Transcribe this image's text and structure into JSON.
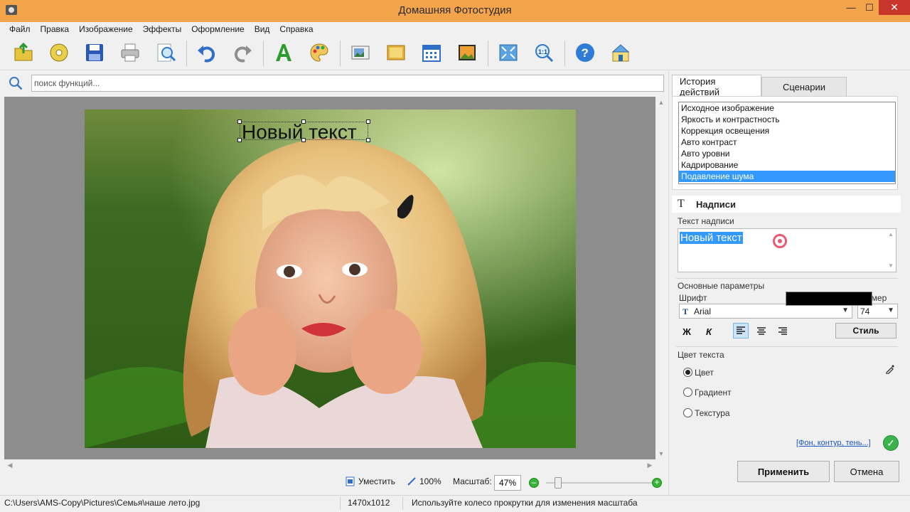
{
  "window": {
    "title": "Домашняя Фотостудия",
    "min_glyph": "—",
    "max_glyph": "☐",
    "close_glyph": "✕"
  },
  "menu": [
    "Файл",
    "Правка",
    "Изображение",
    "Эффекты",
    "Оформление",
    "Вид",
    "Справка"
  ],
  "toolbar": {
    "icons": [
      "open-folder-icon",
      "disc-icon",
      "save-icon",
      "print-icon",
      "preview-icon",
      "undo-icon",
      "redo-icon",
      "text-icon",
      "palette-icon",
      "image-frame-icon",
      "photo-icon",
      "calendar-icon",
      "postcard-icon",
      "fit-screen-icon",
      "zoom-1-1-icon",
      "help-icon",
      "home-icon"
    ]
  },
  "search": {
    "placeholder": "поиск функций..."
  },
  "canvas": {
    "caption": "Новый текст"
  },
  "zoom": {
    "fit_label": "Уместить",
    "actual_label": "100%",
    "scale_label": "Масштаб:",
    "value": "47%",
    "minus": "–",
    "plus": "+"
  },
  "status": {
    "path": "C:\\Users\\AMS-Copy\\Pictures\\Семья\\наше лето.jpg",
    "dimensions": "1470x1012",
    "hint": "Используйте колесо прокрутки для изменения масштаба"
  },
  "panel": {
    "tabs": [
      "История действий",
      "Сценарии"
    ],
    "history": [
      "Исходное изображение",
      "Яркость и контрастность",
      "Коррекция освещения",
      "Авто контраст",
      "Авто уровни",
      "Кадрирование",
      "Подавление шума"
    ],
    "selected_history_index": 6,
    "section_icon": "T",
    "section_title": "Надписи",
    "text_label": "Текст надписи",
    "text_value": "Новый текст",
    "basic_params": "Основные параметры",
    "font_label": "Шрифт",
    "font_icon": "T",
    "font_value": "Arial",
    "size_label": "Размер",
    "size_value": "74",
    "bold": "Ж",
    "italic": "К",
    "style_button": "Стиль",
    "color_section": "Цвет текста",
    "color_option": "Цвет",
    "gradient_option": "Градиент",
    "texture_option": "Текстура",
    "text_color": "#000000",
    "extra_link": "[Фон, контур, тень...]",
    "ok_glyph": "✓",
    "apply_button": "Применить",
    "cancel_button": "Отмена"
  }
}
